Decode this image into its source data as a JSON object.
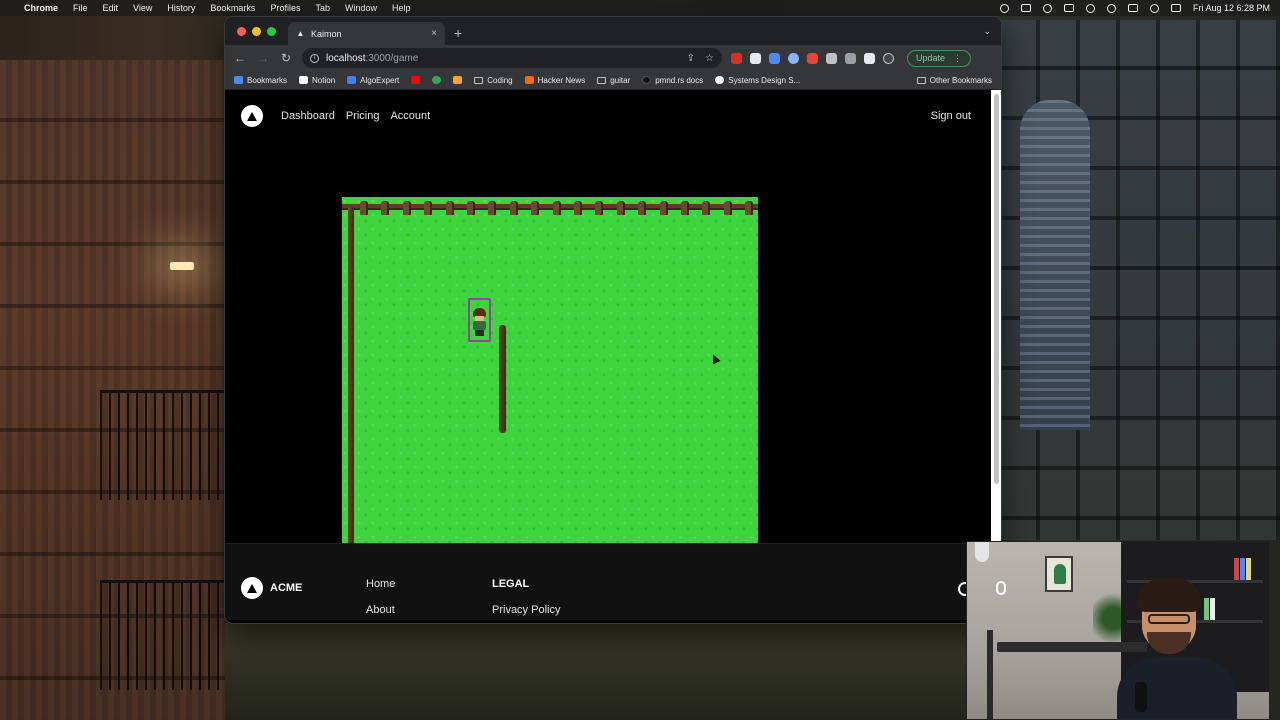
{
  "menubar": {
    "apple": "",
    "items": [
      "Chrome",
      "File",
      "Edit",
      "View",
      "History",
      "Bookmarks",
      "Profiles",
      "Tab",
      "Window",
      "Help"
    ],
    "datetime": "Fri Aug 12  6:28 PM"
  },
  "browser": {
    "tab": {
      "title": "Kaimon",
      "close": "×"
    },
    "new_tab": "+",
    "tab_search": "⌄",
    "nav": {
      "back": "←",
      "forward": "→",
      "reload": "↻"
    },
    "address": {
      "host": "localhost",
      "path": ":3000/game"
    },
    "omnibox_icons": {
      "share": "⇪",
      "star": "☆"
    },
    "update_button": {
      "label": "Update",
      "menu": "⋮"
    },
    "bookmarks": [
      {
        "label": "Bookmarks",
        "icon": "star-icon",
        "color": "#4a8af4"
      },
      {
        "label": "Notion",
        "icon": "notion-icon",
        "color": "#ffffff"
      },
      {
        "label": "AlgoExpert",
        "icon": "algoexpert-icon",
        "color": "#3b82f6"
      },
      {
        "label": "",
        "icon": "youtube-icon",
        "color": "#ff0000"
      },
      {
        "label": "",
        "icon": "chrome-web-icon",
        "color": "#34a853"
      },
      {
        "label": "",
        "icon": "slash-icon",
        "color": "#f5a623"
      },
      {
        "label": "Coding",
        "icon": "folder-icon",
        "color": "#bdc1c6"
      },
      {
        "label": "Hacker News",
        "icon": "hackernews-icon",
        "color": "#ff6600"
      },
      {
        "label": "guitar",
        "icon": "folder-icon",
        "color": "#bdc1c6"
      },
      {
        "label": "pmnd.rs docs",
        "icon": "pmndrs-icon",
        "color": "#111111"
      },
      {
        "label": "Systems Design S...",
        "icon": "github-icon",
        "color": "#ffffff"
      }
    ],
    "other_bookmarks": "Other Bookmarks"
  },
  "site": {
    "nav_links": [
      "Dashboard",
      "Pricing",
      "Account"
    ],
    "signout": "Sign out",
    "footer": {
      "brand": "ACME",
      "col1": [
        "Home",
        "About"
      ],
      "col2_heading": "LEGAL",
      "col2": [
        "Privacy Policy"
      ]
    }
  },
  "game": {
    "grass_color": "#3dd43d",
    "fence_color": "#6b4a32",
    "player_outline": "#9b3fa8"
  }
}
